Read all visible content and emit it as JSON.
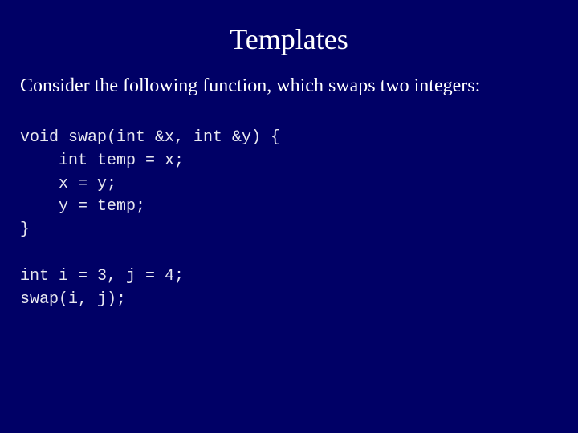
{
  "slide": {
    "title": "Templates",
    "intro": "Consider the following function, which swaps two integers:",
    "code_lines": [
      "void swap(int &x, int &y) {",
      "    int temp = x;",
      "    x = y;",
      "    y = temp;",
      "}",
      "",
      "int i = 3, j = 4;",
      "swap(i, j);"
    ],
    "colors": {
      "background": "#000066",
      "text": "#ffffff"
    }
  }
}
